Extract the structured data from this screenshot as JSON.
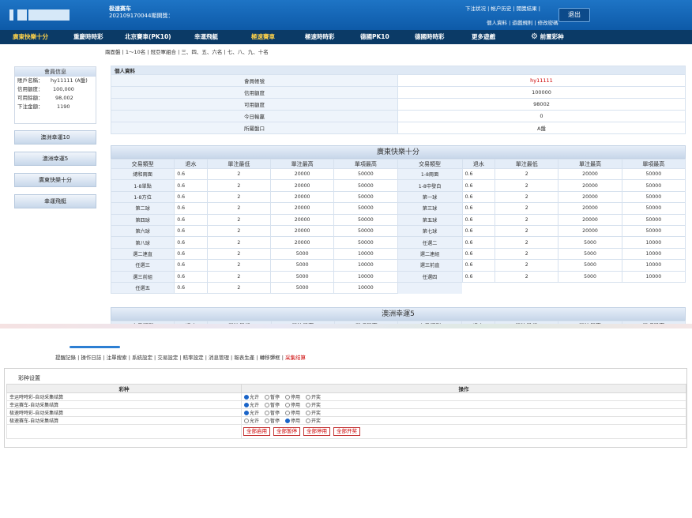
{
  "header": {
    "title": "极速赛车",
    "subtitle": "202109170044期開獎：",
    "links_top": [
      "下注状况",
      "帐户历史",
      "開獎結果"
    ],
    "links_bottom": [
      "個人資料",
      "遊戲規則",
      "修改密碼"
    ],
    "logout": "退出"
  },
  "nav": [
    "廣東快樂十分",
    "重慶時時彩",
    "北京賽車(PK10)",
    "幸運飛艇",
    "極速賽車",
    "極速時時彩",
    "德國PK10",
    "德國時時彩",
    "更多遊戲",
    "前置彩种"
  ],
  "subnav": "兩面盤 | 1～10名 | 冠亞軍組合 | 三、四、五、六名 | 七、八、九、十名",
  "member": {
    "title": "會員信息",
    "rows": [
      [
        "賬戶名稱：",
        "hy11111 (A盤)"
      ],
      [
        "信用額度：",
        "100,000"
      ],
      [
        "可用餘額：",
        "98,002"
      ],
      [
        "下注金額：",
        "1190"
      ]
    ]
  },
  "side_buttons": [
    "澳洲幸運10",
    "澳洲幸運5",
    "廣東快樂十分",
    "幸運飛艇"
  ],
  "info": {
    "caption": "個人資料",
    "rows": [
      [
        "會員帳號",
        "hy11111"
      ],
      [
        "信用額度",
        "100000"
      ],
      [
        "可用額度",
        "98002"
      ],
      [
        "今日輸贏",
        "0"
      ],
      [
        "所屬盤口",
        "A盤"
      ]
    ]
  },
  "odds1": {
    "title": "廣東快樂十分",
    "headers": [
      "交易類型",
      "退水",
      "單注最低",
      "單注最高",
      "單項最高",
      "交易類型",
      "退水",
      "單注最低",
      "單注最高",
      "單項最高"
    ],
    "rows": [
      [
        "總和兩面",
        "0.6",
        "2",
        "20000",
        "50000",
        "1-8兩面",
        "0.6",
        "2",
        "20000",
        "50000"
      ],
      [
        "1-8單點",
        "0.6",
        "2",
        "20000",
        "50000",
        "1-8中發白",
        "0.6",
        "2",
        "20000",
        "50000"
      ],
      [
        "1-8方位",
        "0.6",
        "2",
        "20000",
        "50000",
        "第一球",
        "0.6",
        "2",
        "20000",
        "50000"
      ],
      [
        "第二球",
        "0.6",
        "2",
        "20000",
        "50000",
        "第三球",
        "0.6",
        "2",
        "20000",
        "50000"
      ],
      [
        "第四球",
        "0.6",
        "2",
        "20000",
        "50000",
        "第五球",
        "0.6",
        "2",
        "20000",
        "50000"
      ],
      [
        "第六球",
        "0.6",
        "2",
        "20000",
        "50000",
        "第七球",
        "0.6",
        "2",
        "20000",
        "50000"
      ],
      [
        "第八球",
        "0.6",
        "2",
        "20000",
        "50000",
        "任選二",
        "0.6",
        "2",
        "5000",
        "10000"
      ],
      [
        "選二連直",
        "0.6",
        "2",
        "5000",
        "10000",
        "選二連組",
        "0.6",
        "2",
        "5000",
        "10000"
      ],
      [
        "任選三",
        "0.6",
        "2",
        "5000",
        "10000",
        "選三前直",
        "0.6",
        "2",
        "5000",
        "10000"
      ],
      [
        "選三前組",
        "0.6",
        "2",
        "5000",
        "10000",
        "任選四",
        "0.6",
        "2",
        "5000",
        "10000"
      ],
      [
        "任選五",
        "0.6",
        "2",
        "5000",
        "10000",
        "",
        "",
        "",
        "",
        ""
      ]
    ]
  },
  "odds2": {
    "title": "澳洲幸運5",
    "headers": [
      "交易類型",
      "退水",
      "單注最低",
      "單注最高",
      "單項最高",
      "交易類型",
      "退水",
      "單注最低",
      "單注最高",
      "單項最高"
    ]
  },
  "tabs": {
    "items": [
      "提醒記錄",
      "操作日誌",
      "注單搜索",
      "系統設定",
      "交易設定",
      "賠率設定",
      "消息管理",
      "報表生產",
      "轉移彈框"
    ],
    "active": "采集结算"
  },
  "settings": {
    "label": "彩种设置",
    "col1": "彩种",
    "col2": "操作",
    "options": [
      "允许",
      "暂停",
      "停用",
      "开奖"
    ],
    "rows": [
      {
        "name": "幸运時時彩-自动采集结算",
        "sel": 0
      },
      {
        "name": "幸运赛车-自动采集结算",
        "sel": 0
      },
      {
        "name": "极速時時彩-自动采集结算",
        "sel": 0
      },
      {
        "name": "极速赛车-自动采集结算",
        "sel": 2
      }
    ],
    "buttons": [
      "全部启用",
      "全部暂停",
      "全部停用",
      "全部开奖"
    ]
  }
}
